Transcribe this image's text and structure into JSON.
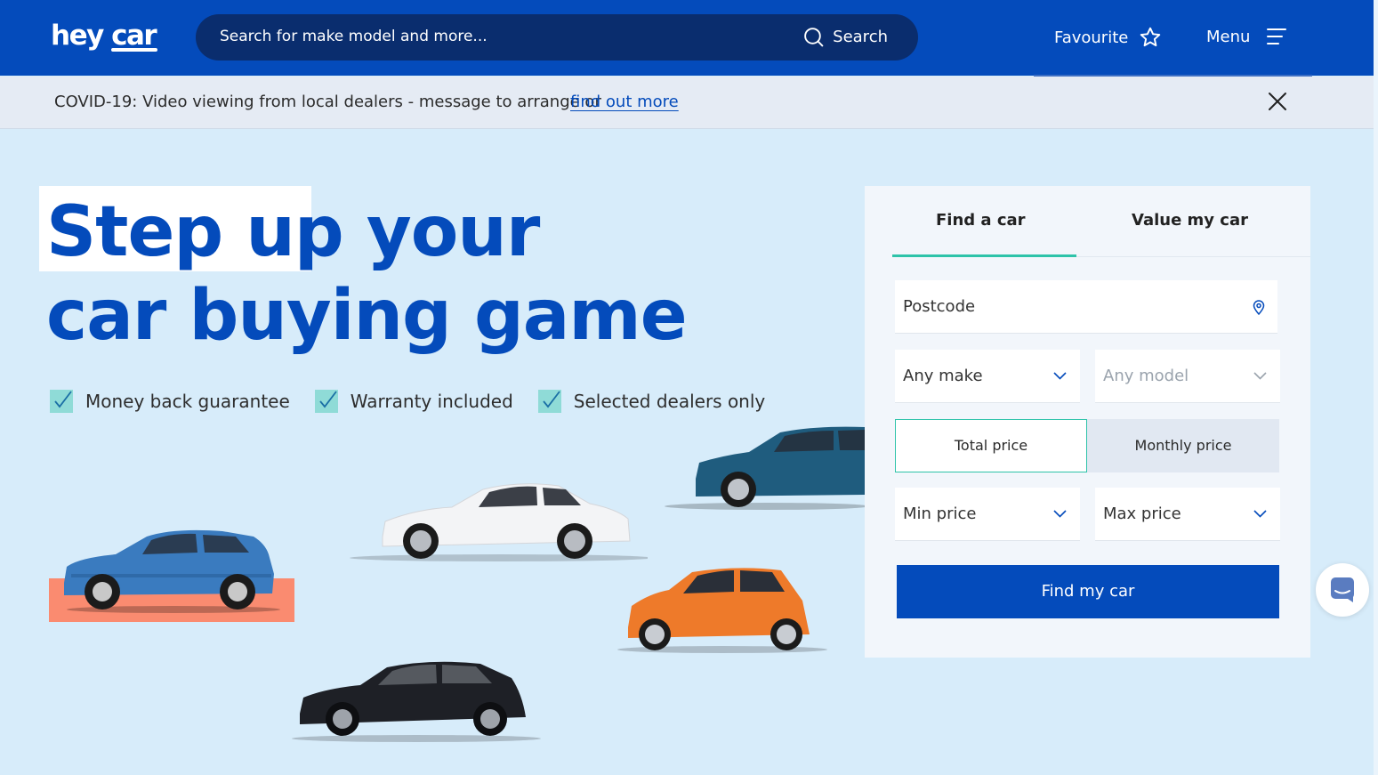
{
  "header": {
    "logo_hey": "hey",
    "logo_car": "car",
    "search_placeholder": "Search for make model and more...",
    "search_button": "Search",
    "favourite_label": "Favourite",
    "menu_label": "Menu"
  },
  "banner": {
    "text": "COVID-19: Video viewing from local dealers - message to arrange or",
    "link": "find out more"
  },
  "hero": {
    "title_part1": "Step up",
    "title_part2": " your",
    "title_line2": "car buying game",
    "benefits": [
      "Money back guarantee",
      "Warranty included",
      "Selected dealers only"
    ]
  },
  "form": {
    "tabs": [
      "Find a car",
      "Value my car"
    ],
    "active_tab": "Find a car",
    "postcode_placeholder": "Postcode",
    "make_placeholder": "Any make",
    "model_placeholder": "Any model",
    "price_toggle": [
      "Total price",
      "Monthly price"
    ],
    "active_price_toggle": "Total price",
    "min_price": "Min price",
    "max_price": "Max price",
    "submit": "Find my car"
  },
  "colors": {
    "brand_blue": "#044bbb",
    "accent_teal": "#2ec3a9",
    "hero_bg": "#d7ecfa",
    "highlight_coral": "#fa8b70"
  }
}
